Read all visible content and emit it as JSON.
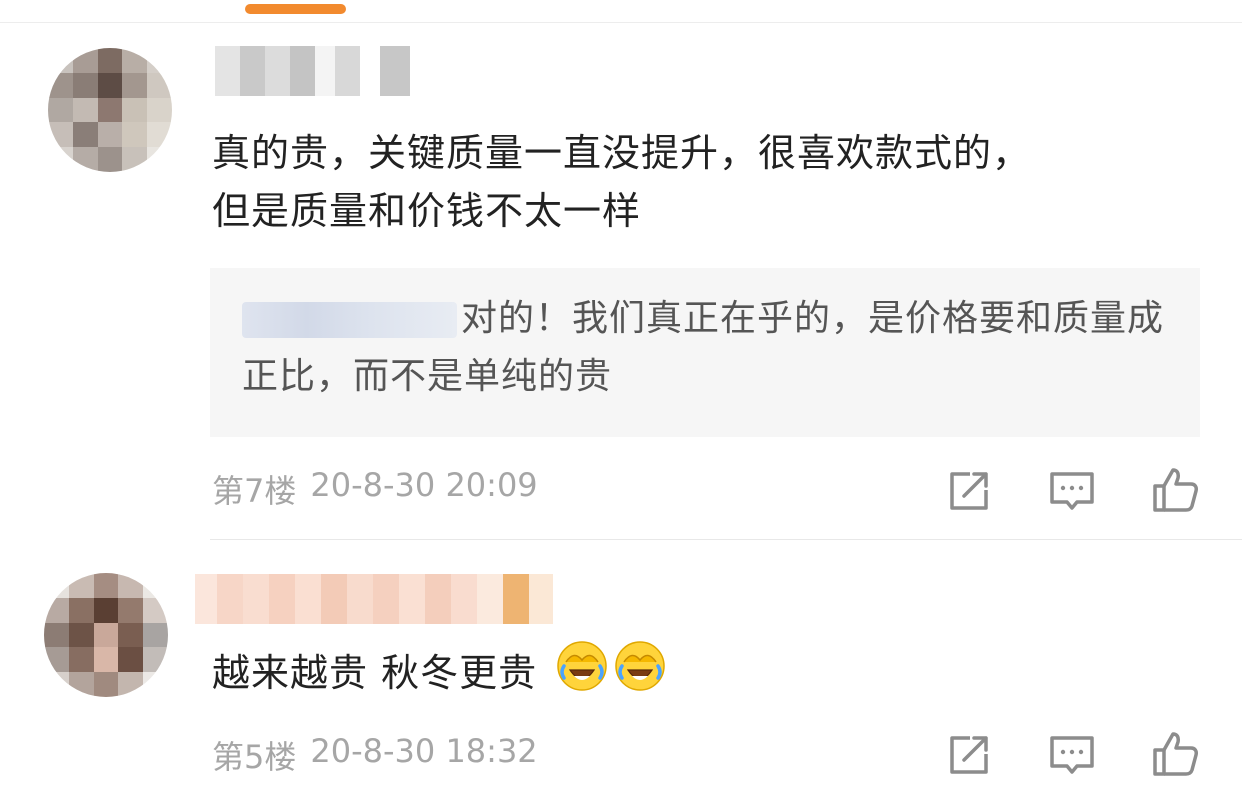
{
  "header": {
    "tab_indicator_color": "#F28A2E"
  },
  "comments": [
    {
      "username_blurred": true,
      "text": "真的贵，关键质量一直没提升，很喜欢款式的，但是质量和价钱不太一样",
      "text_line1": "真的贵，关键质量一直没提升，很喜欢款式的，",
      "text_line2": "但是质量和价钱不太一样",
      "reply": {
        "user_blurred": true,
        "text": "对的！我们真正在乎的，是价格要和质量成正比，而不是单纯的贵"
      },
      "floor": "第7楼",
      "timestamp": "20-8-30 20:09"
    },
    {
      "username_blurred": true,
      "text": "越来越贵 秋冬更贵",
      "emojis": [
        "laugh-cry-emoji",
        "laugh-cry-emoji"
      ],
      "floor": "第5楼",
      "timestamp": "20-8-30 18:32"
    }
  ],
  "actions": {
    "share_icon": "share-icon",
    "reply_icon": "comment-icon",
    "like_icon": "thumbs-up-icon"
  },
  "colors": {
    "text_primary": "#222222",
    "text_meta": "#A6A6A6",
    "icon": "#8C8C8C",
    "reply_bg": "#F6F6F6"
  }
}
